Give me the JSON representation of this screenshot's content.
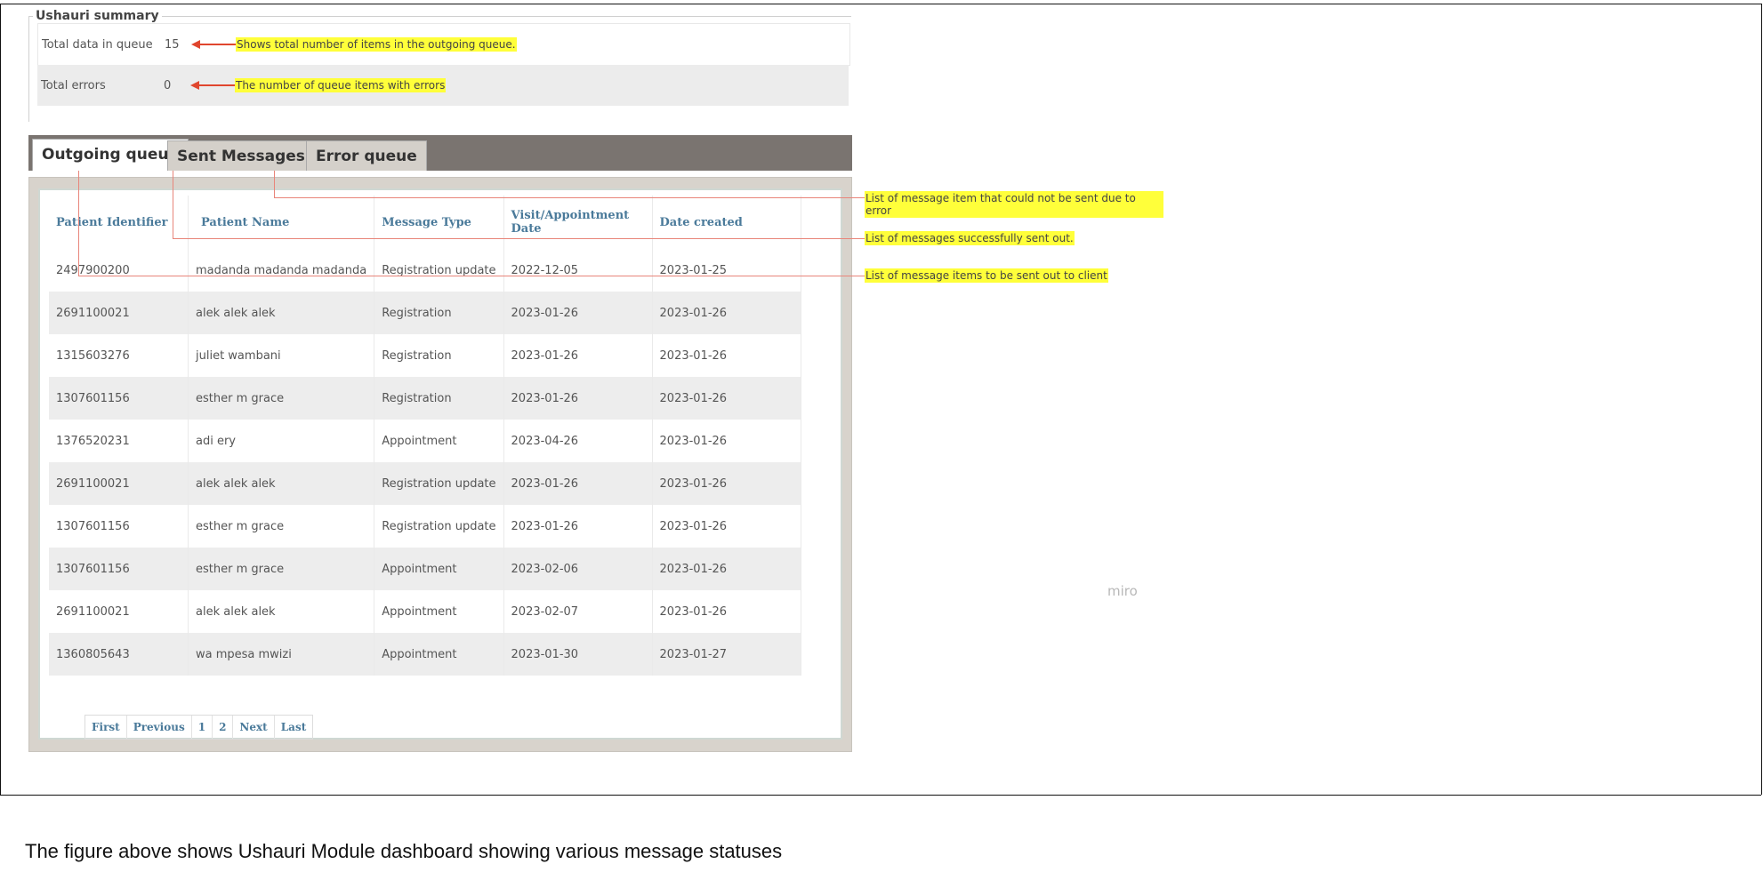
{
  "summary": {
    "legend": "Ushauri summary",
    "rows": [
      {
        "label": "Total data in queue",
        "value": "15",
        "note": "Shows total number of items in the outgoing queue."
      },
      {
        "label": "Total errors",
        "value": "0",
        "note": "The number of queue items with errors"
      }
    ]
  },
  "tabs": [
    {
      "label": "Outgoing queue",
      "active": true
    },
    {
      "label": "Sent Messages",
      "active": false
    },
    {
      "label": "Error queue",
      "active": false
    }
  ],
  "table": {
    "columns": [
      "Patient Identifier",
      "Patient Name",
      "Message Type",
      "Visit/Appointment Date",
      "Date created"
    ],
    "rows": [
      [
        "2497900200",
        "madanda madanda madanda",
        "Registration update",
        "2022-12-05",
        "2023-01-25"
      ],
      [
        "2691100021",
        "alek alek alek",
        "Registration",
        "2023-01-26",
        "2023-01-26"
      ],
      [
        "1315603276",
        "juliet wambani",
        "Registration",
        "2023-01-26",
        "2023-01-26"
      ],
      [
        "1307601156",
        "esther m grace",
        "Registration",
        "2023-01-26",
        "2023-01-26"
      ],
      [
        "1376520231",
        "adi ery",
        "Appointment",
        "2023-04-26",
        "2023-01-26"
      ],
      [
        "2691100021",
        "alek alek alek",
        "Registration update",
        "2023-01-26",
        "2023-01-26"
      ],
      [
        "1307601156",
        "esther m grace",
        "Registration update",
        "2023-01-26",
        "2023-01-26"
      ],
      [
        "1307601156",
        "esther m grace",
        "Appointment",
        "2023-02-06",
        "2023-01-26"
      ],
      [
        "2691100021",
        "alek alek alek",
        "Appointment",
        "2023-02-07",
        "2023-01-26"
      ],
      [
        "1360805643",
        "wa mpesa mwizi",
        "Appointment",
        "2023-01-30",
        "2023-01-27"
      ]
    ]
  },
  "pager": [
    "First",
    "Previous",
    "1",
    "2",
    "Next",
    "Last"
  ],
  "watermark": "miro",
  "annotations": {
    "error_queue": "List of message item that could not be sent due to error",
    "sent": "List of messages successfully sent out.",
    "outgoing": "List of message items to be sent out to client"
  },
  "caption": "The figure above shows Ushauri Module dashboard showing various message statuses",
  "colors": {
    "highlight": "#ffff3a",
    "arrow": "#e0462e",
    "tabbar": "#7a7470",
    "header_text": "#4a7a9a"
  }
}
